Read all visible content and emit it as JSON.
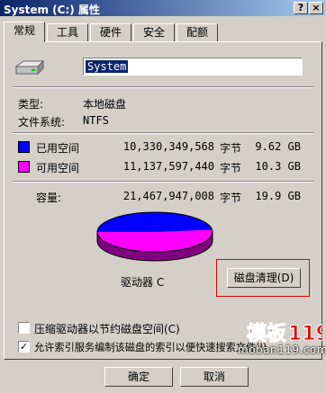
{
  "window": {
    "title": "System (C:) 属性",
    "help_btn": "?",
    "close_btn": "×"
  },
  "tabs": [
    "常规",
    "工具",
    "硬件",
    "安全",
    "配额"
  ],
  "general": {
    "volume_name": "System",
    "type_label": "类型:",
    "type_value": "本地磁盘",
    "fs_label": "文件系统:",
    "fs_value": "NTFS",
    "used_label": "已用空间",
    "used_bytes": "10,330,349,568",
    "used_unit": "字节",
    "used_size": "9.62 GB",
    "free_label": "可用空间",
    "free_bytes": "11,137,597,440",
    "free_unit": "字节",
    "free_size": "10.3 GB",
    "cap_label": "容量:",
    "cap_bytes": "21,467,947,008",
    "cap_unit": "字节",
    "cap_size": "19.9 GB",
    "drive_label": "驱动器 C",
    "cleanup_button": "磁盘清理(D)",
    "compress_label": "压缩驱动器以节约磁盘空间(C)",
    "index_label": "允许索引服务编制该磁盘的索引以便快速搜索文件(I)"
  },
  "colors": {
    "used": "#0000ff",
    "free": "#ff00ff"
  },
  "usage": {
    "used_fraction": 0.481
  },
  "footer": {
    "ok": "确定",
    "cancel": "取消"
  },
  "watermark": {
    "logo": "模板119",
    "url": "moban119.com"
  }
}
